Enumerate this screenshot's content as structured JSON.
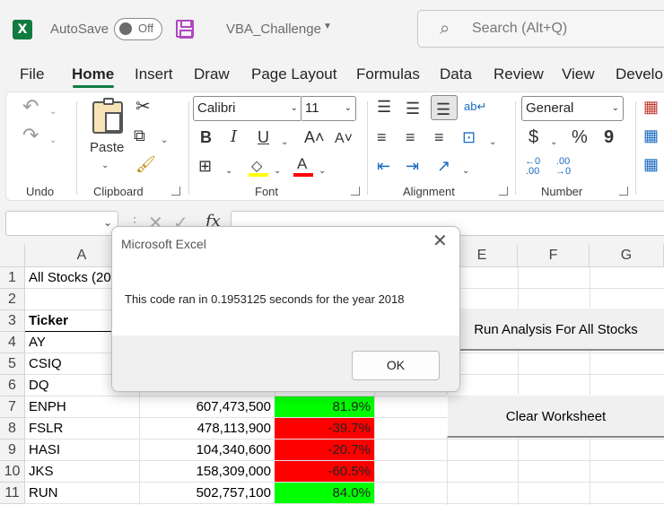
{
  "titlebar": {
    "logo_letter": "X",
    "autosave_label": "AutoSave",
    "autosave_state": "Off",
    "document_name": "VBA_Challenge",
    "search_placeholder": "Search (Alt+Q)"
  },
  "tabs": [
    "File",
    "Home",
    "Insert",
    "Draw",
    "Page Layout",
    "Formulas",
    "Data",
    "Review",
    "View",
    "Develo"
  ],
  "active_tab": "Home",
  "ribbon": {
    "groups": [
      "Undo",
      "Clipboard",
      "Font",
      "Alignment",
      "Number"
    ],
    "paste_label": "Paste",
    "font_name": "Calibri",
    "font_size": "11",
    "number_format": "General",
    "bold": "B",
    "italic": "I",
    "underline": "U",
    "dollar": "$",
    "percent": "%",
    "comma": "9"
  },
  "formula_bar": {
    "fx_label": "fx"
  },
  "sheet": {
    "columns": [
      "A",
      "E",
      "F",
      "G"
    ],
    "rows": [
      "1",
      "2",
      "3",
      "4",
      "5",
      "6",
      "7",
      "8",
      "9",
      "10",
      "11"
    ],
    "title_cell": "All Stocks (20",
    "header_cell": "Ticker",
    "tickers": [
      "AY",
      "CSIQ",
      "DQ",
      "ENPH",
      "FSLR",
      "HASI",
      "JKS",
      "RUN"
    ],
    "volumes": [
      "607,473,500",
      "478,113,900",
      "104,340,600",
      "158,309,000",
      "502,757,100"
    ],
    "returns": [
      "81.9%",
      "-39.7%",
      "-20.7%",
      "-60.5%",
      "84.0%"
    ],
    "return_colors": [
      "#00ff00",
      "#ff0000",
      "#ff0000",
      "#ff0000",
      "#00ff00"
    ],
    "buttons": {
      "run_analysis": "Run Analysis For All Stocks",
      "clear": "Clear Worksheet"
    }
  },
  "dialog": {
    "title": "Microsoft Excel",
    "message": "This code ran in 0.1953125 seconds for the year 2018",
    "ok_label": "OK",
    "close_glyph": "✕"
  }
}
